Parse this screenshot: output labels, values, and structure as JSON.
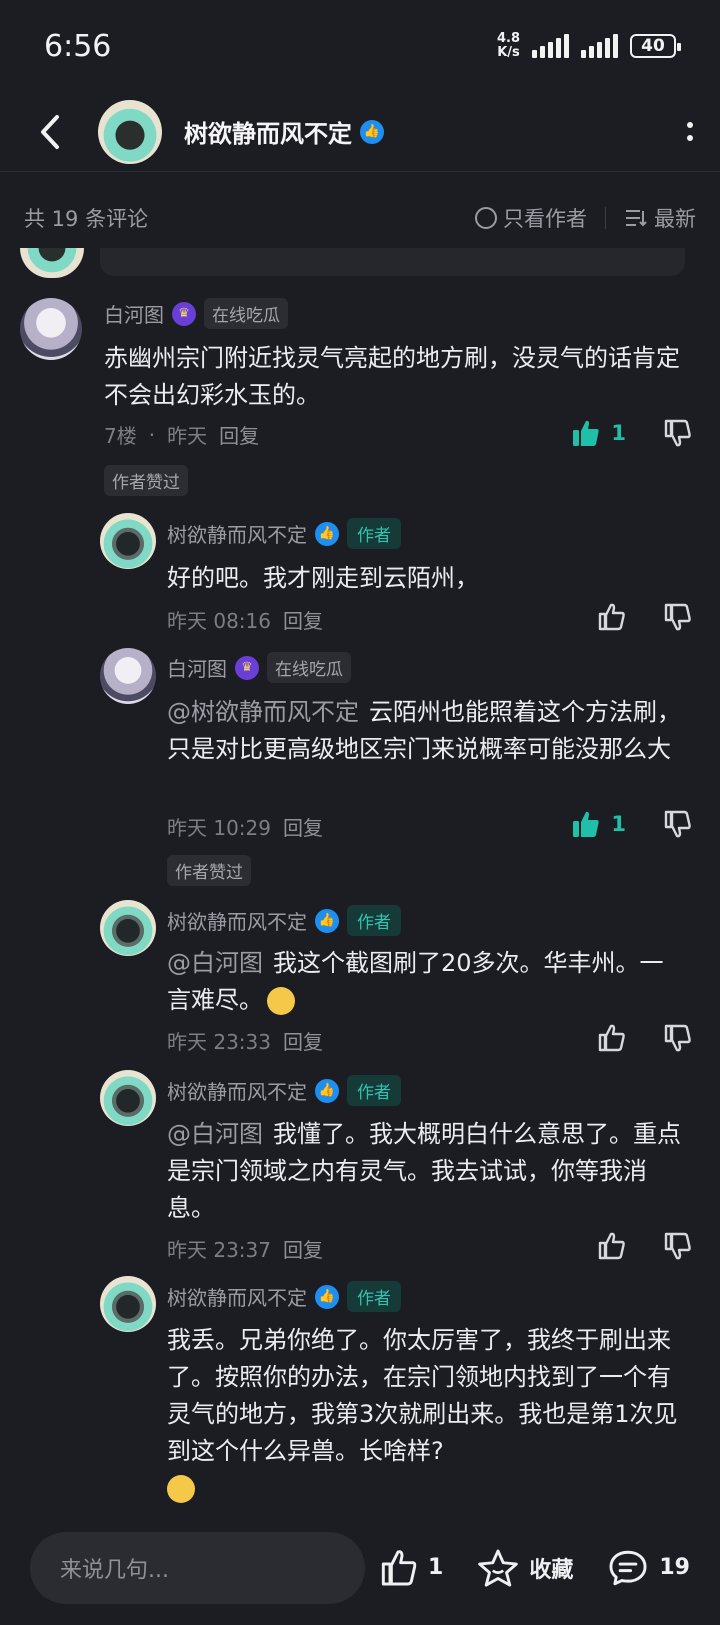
{
  "status": {
    "time": "6:56",
    "net_speed_value": "4.8",
    "net_speed_unit": "K/s",
    "battery": "40"
  },
  "header": {
    "title": "树欲静而风不定"
  },
  "filter": {
    "count_label": "共 19 条评论",
    "only_author": "只看作者",
    "sort": "最新"
  },
  "comments": [
    {
      "author": "白河图",
      "tag": "在线吃瓜",
      "text": "赤幽州宗门附近找灵气亮起的地方刷，没灵气的话肯定不会出幻彩水玉的。",
      "floor": "7楼",
      "time": "昨天",
      "reply": "回复",
      "likes": "1",
      "liked_by_author": "作者赞过"
    },
    {
      "author": "树欲静而风不定",
      "author_label": "作者",
      "text": "好的吧。我才刚走到云陌州，",
      "time": "昨天 08:16",
      "reply": "回复"
    },
    {
      "author": "白河图",
      "tag": "在线吃瓜",
      "mention": "@树欲静而风不定",
      "text": "云陌州也能照着这个方法刷，只是对比更高级地区宗门来说概率可能没那么大",
      "time": "昨天 10:29",
      "reply": "回复",
      "likes": "1",
      "liked_by_author": "作者赞过"
    },
    {
      "author": "树欲静而风不定",
      "author_label": "作者",
      "mention": "@白河图",
      "text": "我这个截图刷了20多次。华丰州。一言难尽。",
      "time": "昨天 23:33",
      "reply": "回复"
    },
    {
      "author": "树欲静而风不定",
      "author_label": "作者",
      "mention": "@白河图",
      "text": "我懂了。我大概明白什么意思了。重点是宗门领域之内有灵气。我去试试，你等我消息。",
      "time": "昨天 23:37",
      "reply": "回复"
    },
    {
      "author": "树欲静而风不定",
      "author_label": "作者",
      "text": "我丢。兄弟你绝了。你太厉害了，我终于刷出来了。按照你的办法，在宗门领地内找到了一个有灵气的地方，我第3次就刷出来。我也是第1次见到这个什么异兽。长啥样?"
    }
  ],
  "bottom": {
    "input_placeholder": "来说几句...",
    "likes": "1",
    "collect": "收藏",
    "comments": "19"
  },
  "colors": {
    "accent": "#20c0a8",
    "background": "#1c1d22"
  }
}
